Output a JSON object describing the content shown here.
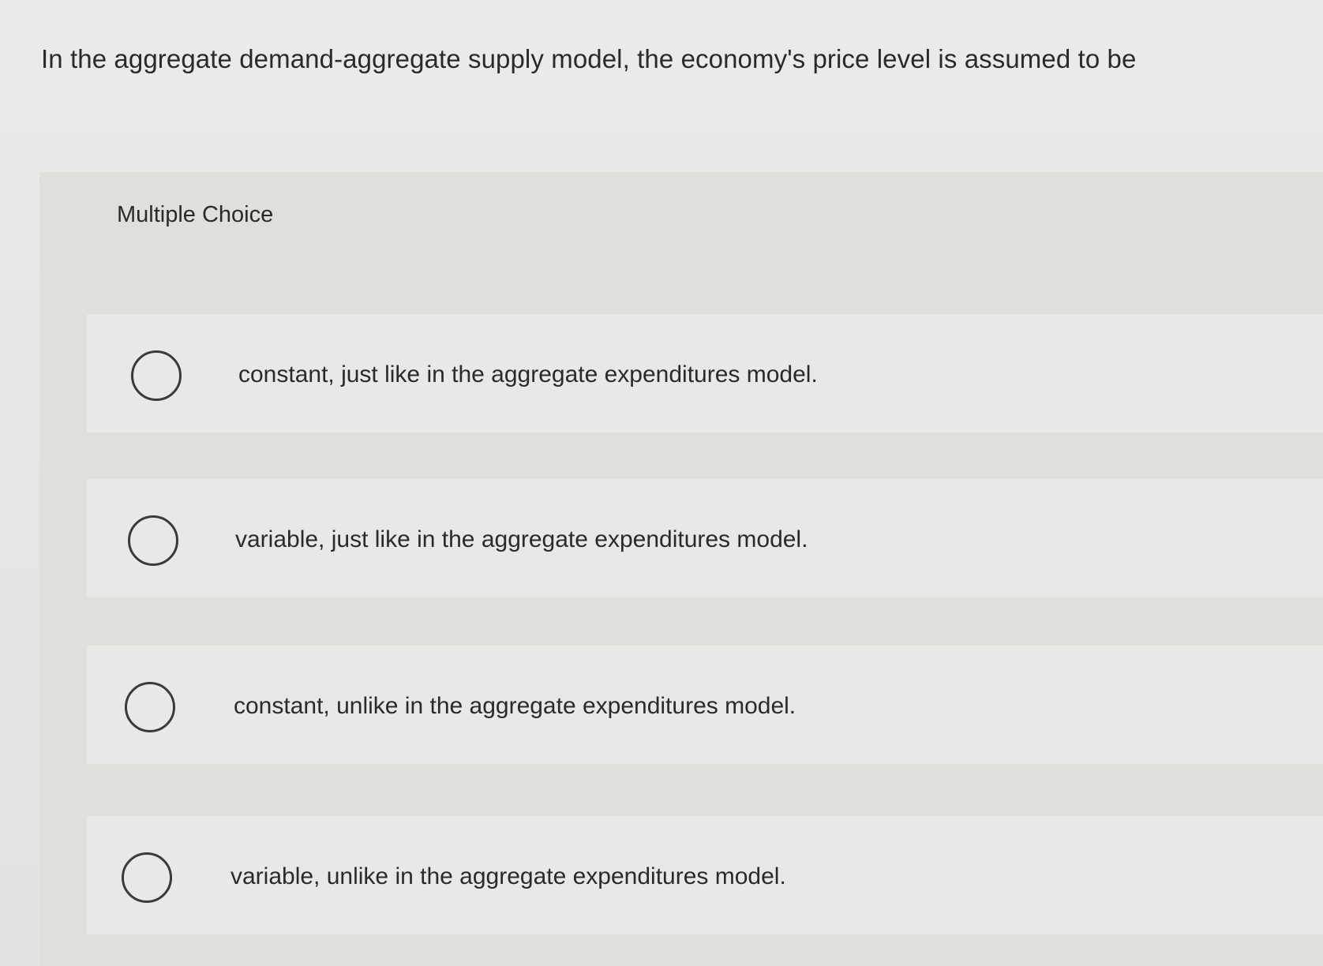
{
  "question": {
    "text": "In the aggregate demand-aggregate supply model, the economy's price level is assumed to be"
  },
  "panel": {
    "type_label": "Multiple Choice"
  },
  "options": [
    {
      "label": "constant, just like in the aggregate expenditures model.",
      "selected": false
    },
    {
      "label": "variable, just like in the aggregate expenditures model.",
      "selected": false
    },
    {
      "label": "constant, unlike in the aggregate expenditures model.",
      "selected": false
    },
    {
      "label": "variable, unlike in the aggregate expenditures model.",
      "selected": false
    }
  ]
}
